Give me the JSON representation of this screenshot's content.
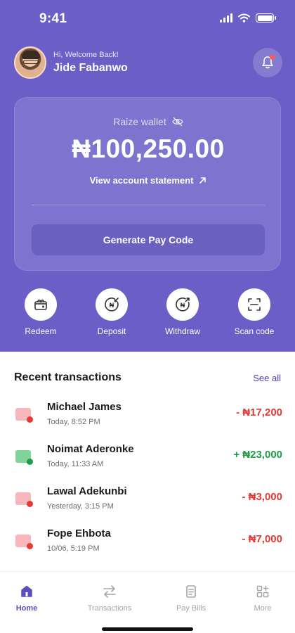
{
  "status_bar": {
    "time": "9:41"
  },
  "header": {
    "greeting": "Hi, Welcome Back!",
    "username": "Jide Fabanwo"
  },
  "wallet": {
    "label": "Raize wallet",
    "balance": "₦100,250.00",
    "statement_link": "View account statement",
    "pay_code_button": "Generate Pay Code"
  },
  "actions": [
    {
      "label": "Redeem",
      "icon": "redeem-icon"
    },
    {
      "label": "Deposit",
      "icon": "deposit-icon"
    },
    {
      "label": "Withdraw",
      "icon": "withdraw-icon"
    },
    {
      "label": "Scan code",
      "icon": "scan-code-icon"
    }
  ],
  "transactions": {
    "title": "Recent transactions",
    "see_all": "See all",
    "items": [
      {
        "name": "Michael James",
        "date": "Today, 8:52 PM",
        "amount": "- ₦17,200",
        "direction": "debit"
      },
      {
        "name": "Noimat Aderonke",
        "date": "Today, 11:33 AM",
        "amount": "+ ₦23,000",
        "direction": "credit"
      },
      {
        "name": "Lawal Adekunbi",
        "date": "Yesterday, 3:15 PM",
        "amount": "- ₦3,000",
        "direction": "debit"
      },
      {
        "name": "Fope Ehbota",
        "date": "10/06, 5:19 PM",
        "amount": "- ₦7,000",
        "direction": "debit"
      }
    ]
  },
  "bottom_nav": [
    {
      "label": "Home",
      "icon": "home-icon",
      "active": true
    },
    {
      "label": "Transactions",
      "icon": "transactions-icon",
      "active": false
    },
    {
      "label": "Pay Bills",
      "icon": "pay-bills-icon",
      "active": false
    },
    {
      "label": "More",
      "icon": "more-icon",
      "active": false
    }
  ],
  "colors": {
    "brand": "#6b5fc7",
    "debit": "#e53935",
    "credit": "#1e9e4a",
    "debit_icon_bg": "#f6b6bb",
    "credit_icon_bg": "#7fd39b",
    "nav_active": "#5a4fc0"
  }
}
